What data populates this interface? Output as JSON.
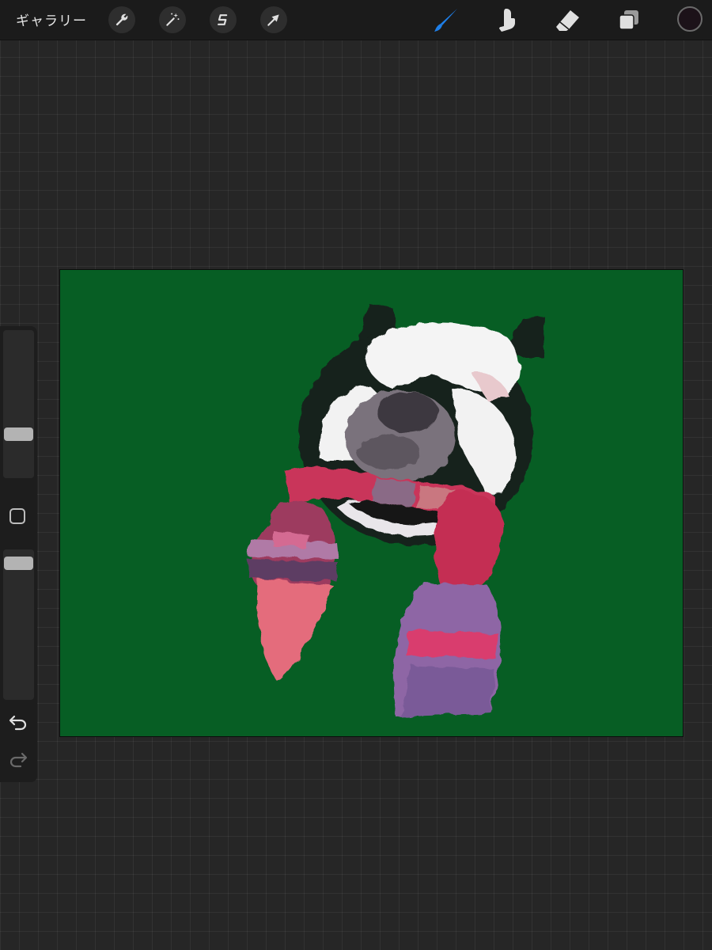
{
  "topbar": {
    "gallery_label": "ギャラリー",
    "left_tools": [
      {
        "name": "actions",
        "icon": "wrench-icon"
      },
      {
        "name": "adjustments",
        "icon": "magic-wand-icon"
      },
      {
        "name": "selection",
        "icon": "selection-s-icon"
      },
      {
        "name": "transform",
        "icon": "arrow-cursor-icon"
      }
    ],
    "right_tools": [
      {
        "name": "brush",
        "icon": "brush-icon",
        "active": true
      },
      {
        "name": "smudge",
        "icon": "smudge-finger-icon",
        "active": false
      },
      {
        "name": "eraser",
        "icon": "eraser-icon",
        "active": false
      },
      {
        "name": "layers",
        "icon": "layers-icon",
        "active": false
      }
    ],
    "current_color": "#1c1219"
  },
  "sidebar": {
    "size_slider_level": 0.27,
    "opacity_slider_level": 0.96,
    "modifier_icon": "square-modifier-icon",
    "undo_icon": "undo-icon",
    "redo_icon": "redo-icon"
  },
  "canvas": {
    "background_color": "#075e24",
    "artwork_subject": "dog-with-scarf-painting"
  },
  "colors": {
    "accent_active_brush": "#1e7fe8",
    "icon": "#e0e0e0"
  }
}
